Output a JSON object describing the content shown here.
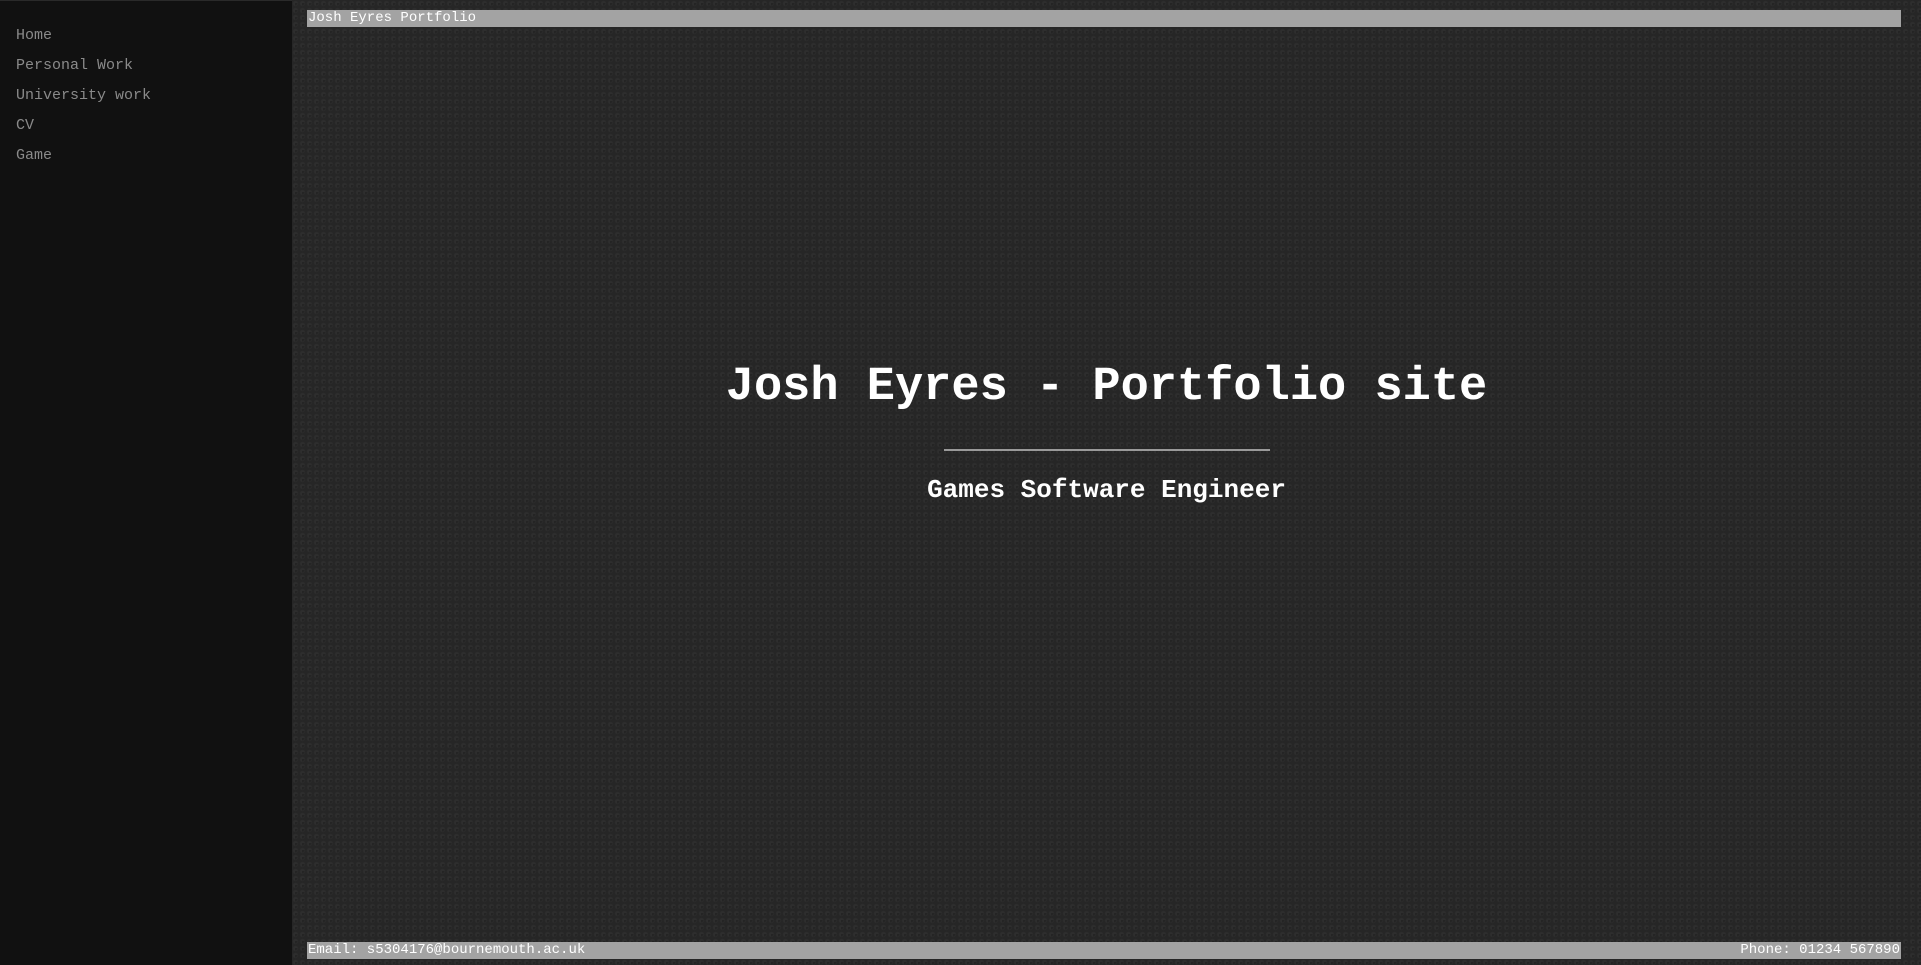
{
  "nav": {
    "items": [
      {
        "label": "Home"
      },
      {
        "label": "Personal Work"
      },
      {
        "label": "University work"
      },
      {
        "label": "CV"
      },
      {
        "label": "Game"
      }
    ]
  },
  "header": {
    "title": "Josh Eyres Portfolio"
  },
  "hero": {
    "title": "Josh Eyres - Portfolio site",
    "subtitle": "Games Software Engineer"
  },
  "footer": {
    "email": "Email: s5304176@bournemouth.ac.uk",
    "phone": "Phone: 01234 567890"
  },
  "colors": {
    "sidebar_bg": "#111111",
    "main_bg": "#262626",
    "bar_bg": "#a3a3a3",
    "nav_text": "#8a8a8a",
    "heading_text": "#ffffff"
  }
}
